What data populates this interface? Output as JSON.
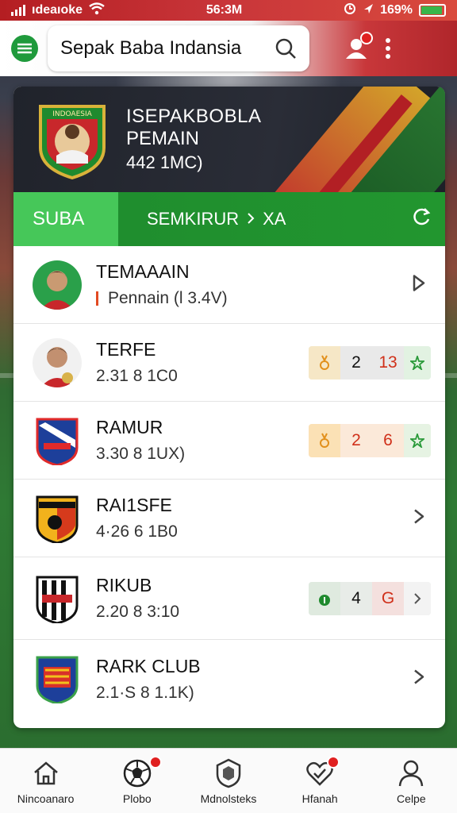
{
  "status_bar": {
    "carrier": "ıdeaıoke",
    "time": "56:3M",
    "battery": "169%"
  },
  "header": {
    "search_text": "Sepak Baba Indansia"
  },
  "hero": {
    "crest_text": "INDOAESIA",
    "line1": "ISEPAKBOBLA",
    "line2": "PEMAIN",
    "line3": "442 1MC)"
  },
  "tabs": {
    "active": "SUBA",
    "rest": "SEMKIRUR",
    "rest_suffix": "XA"
  },
  "list": [
    {
      "name": "TEMAAAIN",
      "meta": "Pennain  (l 3.4V)"
    },
    {
      "name": "TERFE",
      "meta": "2.31  8 1C0",
      "chips": [
        "2",
        "13"
      ]
    },
    {
      "name": "RAMUR",
      "meta": "3.30  8 1UX)",
      "chips": [
        "2",
        "6"
      ]
    },
    {
      "name": "RAI1SFE",
      "meta": "4·26  6 1B0"
    },
    {
      "name": "RIKUB",
      "meta": "2.20  8 3:10",
      "chips": [
        "4",
        "G"
      ]
    },
    {
      "name": "RARK CLUB",
      "meta": "2.1·S  8 1.1K)"
    }
  ],
  "bottom_nav": [
    {
      "label": "Nincoanaro",
      "icon": "home-icon"
    },
    {
      "label": "Plobo",
      "icon": "soccer-ball-icon"
    },
    {
      "label": "Mdnolsteks",
      "icon": "shield-icon"
    },
    {
      "label": "Hfanah",
      "icon": "heart-check-icon"
    },
    {
      "label": "Celpe",
      "icon": "profile-icon"
    }
  ],
  "colors": {
    "primary_green": "#22962f",
    "accent_red": "#c9363a",
    "active_tab": "#46c759"
  }
}
